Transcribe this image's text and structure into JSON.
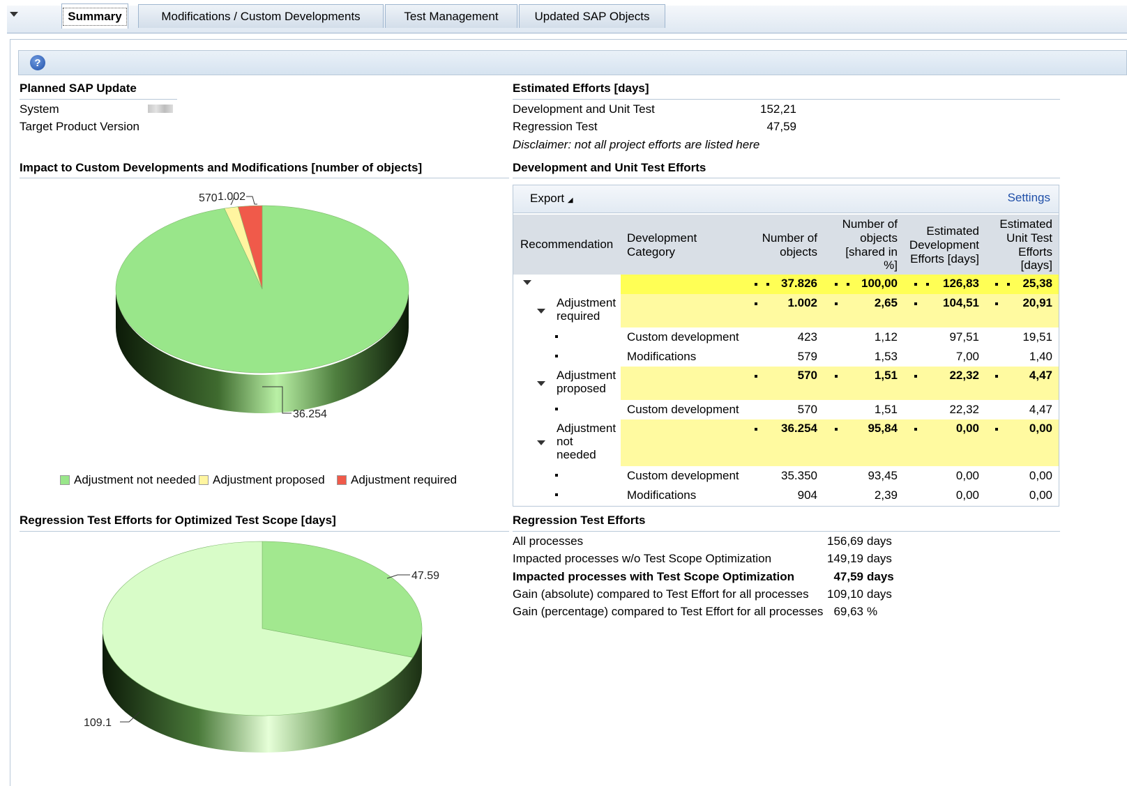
{
  "tabs": [
    {
      "label": "Summary"
    },
    {
      "label": "Modifications / Custom Developments"
    },
    {
      "label": "Test Management"
    },
    {
      "label": "Updated SAP Objects"
    }
  ],
  "help_icon": "?",
  "planned": {
    "title": "Planned SAP Update",
    "system_label": "System",
    "target_label": "Target Product Version"
  },
  "estimated": {
    "title": "Estimated Efforts [days]",
    "dev_label": "Development and Unit Test",
    "dev_value": "152,21",
    "reg_label": "Regression Test",
    "reg_value": "47,59",
    "disclaimer": "Disclaimer: not all project efforts are listed here"
  },
  "impact_title": "Impact to Custom Developments and Modifications [number of objects]",
  "dev_unit_title": "Development and Unit Test Efforts",
  "table": {
    "export_label": "Export",
    "settings_label": "Settings",
    "headers": {
      "recommendation": "Recommendation",
      "category_1": "Development",
      "category_2": "Category",
      "objects_1": "Number of",
      "objects_2": "objects",
      "shared_1": "Number of",
      "shared_2": "objects",
      "shared_3": "[shared in",
      "shared_4": "%]",
      "dev_1": "Estimated",
      "dev_2": "Development",
      "dev_3": "Efforts [days]",
      "unit_1": "Estimated",
      "unit_2": "Unit Test",
      "unit_3": "Efforts",
      "unit_4": "[days]"
    },
    "total": {
      "objects": "37.826",
      "shared": "100,00",
      "dev": "126,83",
      "unit": "25,38"
    },
    "group1": {
      "label_1": "Adjustment",
      "label_2": "required",
      "objects": "1.002",
      "shared": "2,65",
      "dev": "104,51",
      "unit": "20,91"
    },
    "g1r1": {
      "category": "Custom development",
      "objects": "423",
      "shared": "1,12",
      "dev": "97,51",
      "unit": "19,51"
    },
    "g1r2": {
      "category": "Modifications",
      "objects": "579",
      "shared": "1,53",
      "dev": "7,00",
      "unit": "1,40"
    },
    "group2": {
      "label_1": "Adjustment",
      "label_2": "proposed",
      "objects": "570",
      "shared": "1,51",
      "dev": "22,32",
      "unit": "4,47"
    },
    "g2r1": {
      "category": "Custom development",
      "objects": "570",
      "shared": "1,51",
      "dev": "22,32",
      "unit": "4,47"
    },
    "group3": {
      "label_1": "Adjustment",
      "label_2": "not",
      "label_3": "needed",
      "objects": "36.254",
      "shared": "95,84",
      "dev": "0,00",
      "unit": "0,00"
    },
    "g3r1": {
      "category": "Custom development",
      "objects": "35.350",
      "shared": "93,45",
      "dev": "0,00",
      "unit": "0,00"
    },
    "g3r2": {
      "category": "Modifications",
      "objects": "904",
      "shared": "2,39",
      "dev": "0,00",
      "unit": "0,00"
    }
  },
  "regression_chart_title": "Regression Test Efforts for Optimized Test Scope [days]",
  "regression": {
    "title": "Regression Test Efforts",
    "rows": [
      {
        "label": "All processes",
        "value": "156,69",
        "unit": "days"
      },
      {
        "label": "Impacted processes w/o Test Scope Optimization",
        "value": "149,19",
        "unit": "days"
      },
      {
        "label": "Impacted processes with Test Scope Optimization",
        "value": "47,59",
        "unit": "days"
      },
      {
        "label": "Gain (absolute) compared to Test Effort for all processes",
        "value": "109,10",
        "unit": "days"
      },
      {
        "label": "Gain (percentage) compared to Test Effort for all processes",
        "value": "69,63",
        "unit": "%"
      }
    ]
  },
  "colors": {
    "not_needed": "#99e68a",
    "proposed": "#fff5a0",
    "required": "#f05a4a",
    "optimized": "#a2e88f",
    "gain": "#d8fcc8"
  },
  "chart_data": [
    {
      "type": "pie",
      "categories": [
        "Adjustment not needed",
        "Adjustment proposed",
        "Adjustment required"
      ],
      "values": [
        36254,
        570,
        1002
      ],
      "labels": [
        "36.254",
        "570",
        "1.002"
      ],
      "legend": [
        "Adjustment not needed",
        "Adjustment proposed",
        "Adjustment required"
      ],
      "legend_position": "bottom"
    },
    {
      "type": "pie",
      "values": [
        47.59,
        109.1
      ],
      "labels": [
        "47.59",
        "109.1"
      ]
    }
  ]
}
